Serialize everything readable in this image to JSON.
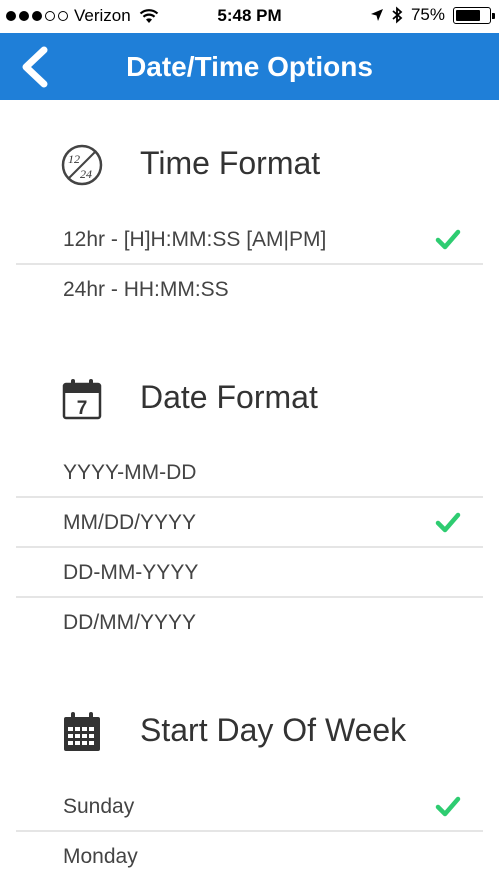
{
  "status_bar": {
    "carrier": "Verizon",
    "time": "5:48 PM",
    "battery_text": "75%",
    "battery_level": 0.75
  },
  "nav": {
    "title": "Date/Time Options",
    "back_icon": "chevron-left-icon"
  },
  "time_format": {
    "title": "Time Format",
    "icon": "clock-12-24-icon",
    "options": [
      {
        "label": "12hr - [H]H:MM:SS [AM|PM]",
        "selected": true
      },
      {
        "label": "24hr - HH:MM:SS",
        "selected": false
      }
    ]
  },
  "date_format": {
    "title": "Date Format",
    "icon": "calendar-day-icon",
    "icon_text": "7",
    "options": [
      {
        "label": "YYYY-MM-DD",
        "selected": false
      },
      {
        "label": "MM/DD/YYYY",
        "selected": true
      },
      {
        "label": "DD-MM-YYYY",
        "selected": false
      },
      {
        "label": "DD/MM/YYYY",
        "selected": false
      }
    ]
  },
  "start_day": {
    "title": "Start Day Of Week",
    "icon": "calendar-grid-icon",
    "options": [
      {
        "label": "Sunday",
        "selected": true
      },
      {
        "label": "Monday",
        "selected": false
      }
    ]
  },
  "colors": {
    "nav_blue": "#1f7fd8",
    "check_green": "#2ecc71"
  }
}
